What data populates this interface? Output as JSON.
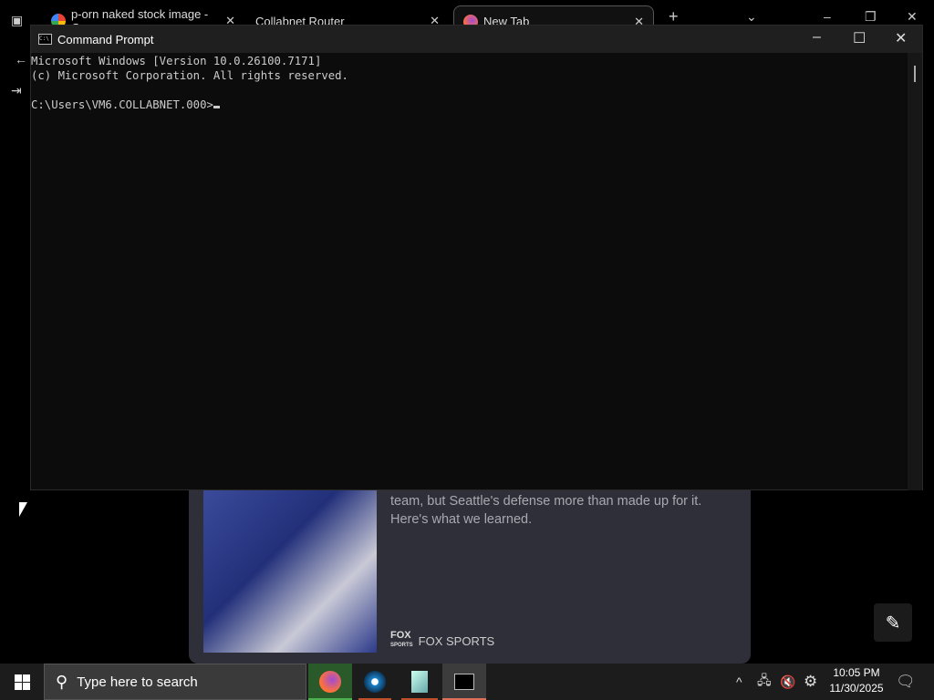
{
  "browser": {
    "tabs": [
      {
        "label": "p-orn naked stock image - Goo",
        "icon": "google-icon"
      },
      {
        "label": "Collabnet Router",
        "icon": ""
      },
      {
        "label": "New Tab",
        "icon": "firefox-icon",
        "active": true
      }
    ],
    "new_tab": "+",
    "tab_list": "⌄"
  },
  "cmd": {
    "title": "Command Prompt",
    "lines": [
      "Microsoft Windows [Version 10.0.26100.7171]",
      "(c) Microsoft Corporation. All rights reserved.",
      "",
      "C:\\Users\\VM6.COLLABNET.000>"
    ]
  },
  "news": {
    "summary": "team, but Seattle's defense more than made up for it. Here's what we learned.",
    "source": "FOX SPORTS",
    "logo_text": "FOX SPORTS"
  },
  "taskbar": {
    "search_placeholder": "Type here to search",
    "apps": [
      {
        "name": "firefox",
        "color": "#ff7139"
      },
      {
        "name": "steam",
        "color": "#1b7fc4"
      },
      {
        "name": "notepad",
        "color": "#7fc7c0"
      },
      {
        "name": "command-prompt",
        "color": "#888"
      }
    ],
    "time": "10:05 PM",
    "date": "11/30/2025"
  }
}
